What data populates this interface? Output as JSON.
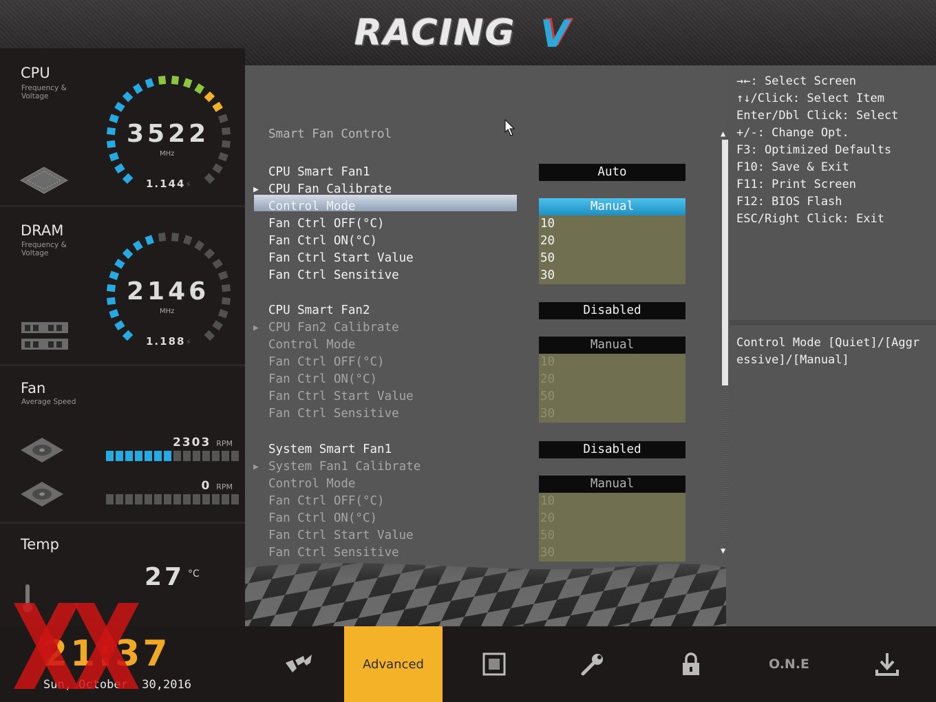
{
  "header": {
    "logo_text": "RACING",
    "logo_mark": "V"
  },
  "sidebar": {
    "cpu": {
      "title": "CPU",
      "subtitle": "Frequency & Voltage",
      "frequency": "3522",
      "unit": "MHz",
      "voltage": "1.144"
    },
    "dram": {
      "title": "DRAM",
      "subtitle": "Frequency & Voltage",
      "frequency": "2146",
      "unit": "MHz",
      "voltage": "1.188"
    },
    "fan": {
      "title": "Fan",
      "subtitle": "Average Speed",
      "fans": [
        {
          "rpm": "2303",
          "unit": "RPM",
          "level": 0.5
        },
        {
          "rpm": "0",
          "unit": "RPM",
          "level": 0
        }
      ]
    },
    "temp": {
      "title": "Temp",
      "value": "27",
      "unit": "°C"
    }
  },
  "main": {
    "section_title": "Smart Fan Control",
    "rows": [
      {
        "label": "CPU Smart Fan1",
        "value": "Auto",
        "style": "black",
        "dim": false,
        "arrow": false
      },
      {
        "label": "CPU Fan Calibrate",
        "value": "",
        "style": "none",
        "dim": false,
        "arrow": true
      },
      {
        "label": "Control Mode",
        "value": "Manual",
        "style": "selected",
        "dim": false,
        "arrow": false,
        "selected": true
      },
      {
        "label": "Fan Ctrl OFF(°C)",
        "value": "10",
        "style": "olive",
        "dim": false,
        "arrow": false
      },
      {
        "label": "Fan Ctrl ON(°C)",
        "value": "20",
        "style": "olive",
        "dim": false,
        "arrow": false
      },
      {
        "label": "Fan Ctrl Start Value",
        "value": "50",
        "style": "olive",
        "dim": false,
        "arrow": false
      },
      {
        "label": "Fan Ctrl Sensitive",
        "value": "30",
        "style": "olive",
        "dim": false,
        "arrow": false
      },
      {
        "label": "CPU Smart Fan2",
        "value": "Disabled",
        "style": "black",
        "dim": false,
        "arrow": false
      },
      {
        "label": "CPU Fan2 Calibrate",
        "value": "",
        "style": "none",
        "dim": true,
        "arrow": true
      },
      {
        "label": "Control Mode",
        "value": "Manual",
        "style": "black",
        "dim": true,
        "arrow": false
      },
      {
        "label": "Fan Ctrl OFF(°C)",
        "value": "10",
        "style": "olive",
        "dim": true,
        "arrow": false
      },
      {
        "label": "Fan Ctrl ON(°C)",
        "value": "20",
        "style": "olive",
        "dim": true,
        "arrow": false
      },
      {
        "label": "Fan Ctrl Start Value",
        "value": "50",
        "style": "olive",
        "dim": true,
        "arrow": false
      },
      {
        "label": "Fan Ctrl Sensitive",
        "value": "30",
        "style": "olive",
        "dim": true,
        "arrow": false
      },
      {
        "label": "System Smart Fan1",
        "value": "Disabled",
        "style": "black",
        "dim": false,
        "arrow": false
      },
      {
        "label": "System Fan1 Calibrate",
        "value": "",
        "style": "none",
        "dim": true,
        "arrow": true
      },
      {
        "label": "Control Mode",
        "value": "Manual",
        "style": "black",
        "dim": true,
        "arrow": false
      },
      {
        "label": "Fan Ctrl OFF(°C)",
        "value": "10",
        "style": "olive",
        "dim": true,
        "arrow": false
      },
      {
        "label": "Fan Ctrl ON(°C)",
        "value": "20",
        "style": "olive",
        "dim": true,
        "arrow": false
      },
      {
        "label": "Fan Ctrl Start Value",
        "value": "50",
        "style": "olive",
        "dim": true,
        "arrow": false
      },
      {
        "label": "Fan Ctrl Sensitive",
        "value": "30",
        "style": "olive",
        "dim": true,
        "arrow": false
      }
    ]
  },
  "help": {
    "keys": [
      "→←: Select Screen",
      "↑↓/Click: Select Item",
      "Enter/Dbl Click: Select",
      "+/-: Change Opt.",
      "F3: Optimized Defaults",
      "F10: Save & Exit",
      "F11: Print Screen",
      "F12: BIOS Flash",
      "ESC/Right Click: Exit"
    ],
    "description": "Control Mode [Quiet]/[Aggressive]/[Manual]"
  },
  "footer": {
    "time": "21:37",
    "date": "Sun, October  30,2016",
    "tabs": [
      {
        "name": "main",
        "icon": "racing-logo-icon",
        "label": ""
      },
      {
        "name": "advanced",
        "icon": "",
        "label": "Advanced",
        "active": true
      },
      {
        "name": "chipset",
        "icon": "chip-icon",
        "label": ""
      },
      {
        "name": "tools",
        "icon": "wrench-icon",
        "label": ""
      },
      {
        "name": "security",
        "icon": "lock-icon",
        "label": ""
      },
      {
        "name": "one",
        "icon": "",
        "label": "O.N.E"
      },
      {
        "name": "save-exit",
        "icon": "download-icon",
        "label": ""
      }
    ]
  },
  "colors": {
    "accent": "#f3b227",
    "blue": "#27a9e1",
    "panel": "#565656",
    "olive": "#707051"
  }
}
